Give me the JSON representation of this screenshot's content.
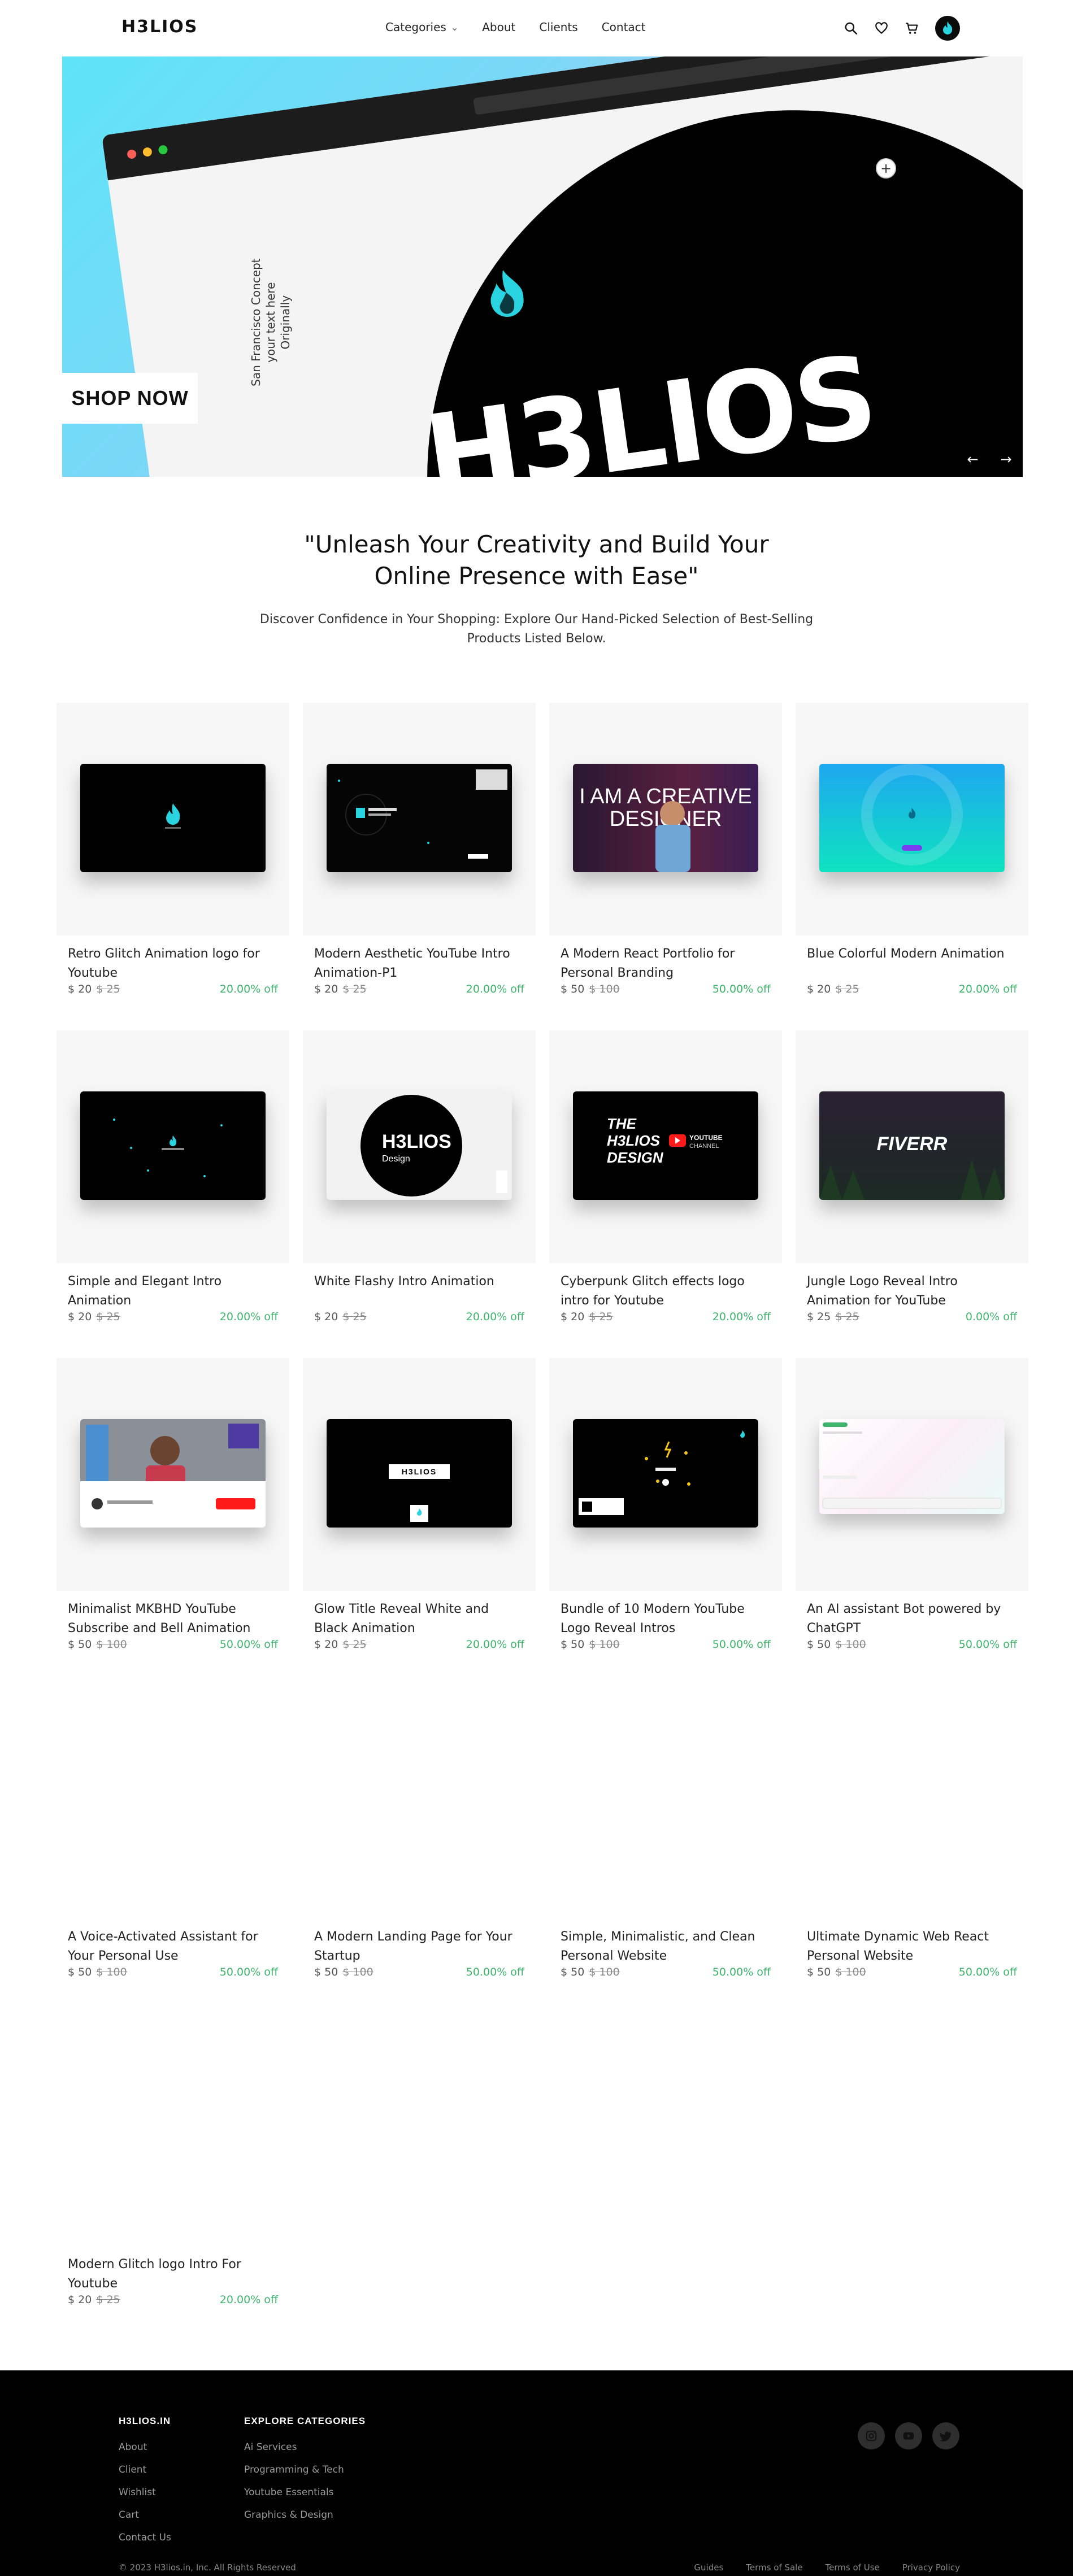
{
  "nav": {
    "logo": "H3LIOS",
    "links": [
      "Categories",
      "About",
      "Clients",
      "Contact"
    ]
  },
  "hero": {
    "brand_word": "H3LIOS",
    "vertical_text_1": "San Francisco Concept",
    "vertical_text_2": "your text here",
    "vertical_text_3": "Originally",
    "cta": "SHOP NOW",
    "prev": "←",
    "next": "→"
  },
  "tagline": {
    "title": "\"Unleash Your Creativity and Build Your Online Presence with Ease\"",
    "subtitle": "Discover Confidence in Your Shopping: Explore Our Hand-Picked Selection of Best-Selling Products Listed Below."
  },
  "products": [
    {
      "title": "Retro Glitch Animation logo for Youtube",
      "price": "$ 20",
      "old": "$ 25",
      "off": "20.00% off"
    },
    {
      "title": "Modern Aesthetic YouTube Intro Animation-P1",
      "price": "$ 20",
      "old": "$ 25",
      "off": "20.00% off"
    },
    {
      "title": "A Modern React Portfolio for Personal Branding",
      "price": "$ 50",
      "old": "$ 100",
      "off": "50.00% off"
    },
    {
      "title": "Blue Colorful Modern Animation",
      "price": "$ 20",
      "old": "$ 25",
      "off": "20.00% off"
    },
    {
      "title": "Simple and Elegant Intro Animation",
      "price": "$ 20",
      "old": "$ 25",
      "off": "20.00% off"
    },
    {
      "title": "White Flashy Intro Animation",
      "price": "$ 20",
      "old": "$ 25",
      "off": "20.00% off"
    },
    {
      "title": "Cyberpunk Glitch effects logo intro for Youtube",
      "price": "$ 20",
      "old": "$ 25",
      "off": "20.00% off"
    },
    {
      "title": "Jungle Logo Reveal Intro Animation for YouTube",
      "price": "$ 25",
      "old": "$ 25",
      "off": "0.00% off"
    },
    {
      "title": "Minimalist MKBHD YouTube Subscribe and Bell Animation",
      "price": "$ 50",
      "old": "$ 100",
      "off": "50.00% off"
    },
    {
      "title": "Glow Title Reveal White and Black Animation",
      "price": "$ 20",
      "old": "$ 25",
      "off": "20.00% off"
    },
    {
      "title": "Bundle of 10 Modern YouTube Logo Reveal Intros",
      "price": "$ 50",
      "old": "$ 100",
      "off": "50.00% off"
    },
    {
      "title": "An AI assistant Bot powered by ChatGPT",
      "price": "$ 50",
      "old": "$ 100",
      "off": "50.00% off"
    },
    {
      "title": "A Voice-Activated Assistant for Your Personal Use",
      "price": "$ 50",
      "old": "$ 100",
      "off": "50.00% off"
    },
    {
      "title": "A Modern Landing Page for Your Startup",
      "price": "$ 50",
      "old": "$ 100",
      "off": "50.00% off"
    },
    {
      "title": "Simple, Minimalistic, and Clean Personal Website",
      "price": "$ 50",
      "old": "$ 100",
      "off": "50.00% off"
    },
    {
      "title": "Ultimate Dynamic Web React Personal Website",
      "price": "$ 50",
      "old": "$ 100",
      "off": "50.00% off"
    },
    {
      "title": "Modern Glitch logo Intro For Youtube",
      "price": "$ 20",
      "old": "$ 25",
      "off": "20.00% off"
    }
  ],
  "thumb_text": {
    "designer_line1": "I AM A CREATIVE",
    "designer_line2": "DESIGNER",
    "yt_line1": "THE",
    "yt_line2": "H3LIOS",
    "yt_line3": "DESIGN",
    "yt_channel": "YOUTUBE",
    "yt_channel2": "CHANNEL",
    "fiverr": "FIVERR",
    "flashy_word": "H3LIOS",
    "flashy_sub": "Design",
    "glow_word": "H3LIOS"
  },
  "footer": {
    "col1_head": "H3LIOS.IN",
    "col1_items": [
      "About",
      "Client",
      "Wishlist",
      "Cart",
      "Contact Us"
    ],
    "col2_head": "EXPLORE CATEGORIES",
    "col2_items": [
      "Ai Services",
      "Programming & Tech",
      "Youtube Essentials",
      "Graphics & Design"
    ],
    "copyright": "© 2023 H3lios.in, Inc. All Rights Reserved",
    "links": [
      "Guides",
      "Terms of Sale",
      "Terms of Use",
      "Privacy Policy"
    ]
  },
  "colors": {
    "accent_green": "#3db36b",
    "brand_teal": "#29d3e0",
    "footer_bg": "#000000"
  }
}
